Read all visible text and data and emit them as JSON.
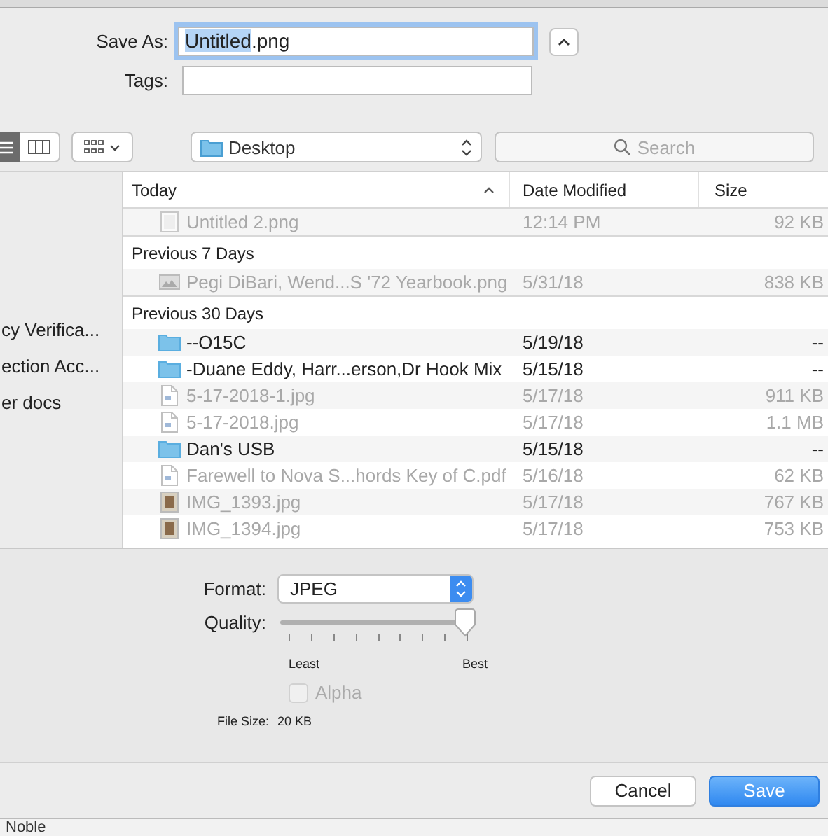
{
  "save_as": {
    "label": "Save As:",
    "value_selected": "Untitled",
    "value_rest": ".png"
  },
  "tags": {
    "label": "Tags:"
  },
  "view_modes": [
    {
      "kind": "list",
      "selected": true
    },
    {
      "kind": "columns",
      "selected": false
    }
  ],
  "location": {
    "label": "Desktop"
  },
  "search": {
    "placeholder": "Search"
  },
  "sidebar": {
    "items": [
      {
        "label": "cy Verifica..."
      },
      {
        "label": "ection Acc..."
      },
      {
        "label": "er docs"
      }
    ]
  },
  "columns": [
    {
      "label": "Today",
      "sorted": true
    },
    {
      "label": "Date Modified",
      "sorted": false
    },
    {
      "label": "Size",
      "sorted": false
    }
  ],
  "rows": [
    {
      "kind": "blank",
      "name": "Untitled 2.png",
      "date": "12:14 PM",
      "size": "92 KB",
      "disabled": true
    },
    {
      "kind": "group",
      "name": "Previous 7 Days"
    },
    {
      "kind": "image",
      "name": "Pegi DiBari, Wend...S '72 Yearbook.png",
      "date": "5/31/18",
      "size": "838 KB",
      "disabled": true
    },
    {
      "kind": "group",
      "name": "Previous 30 Days"
    },
    {
      "kind": "folder",
      "name": "--O15C",
      "date": "5/19/18",
      "size": "--",
      "disabled": false
    },
    {
      "kind": "folder",
      "name": "-Duane Eddy, Harr...erson,Dr Hook Mix",
      "date": "5/15/18",
      "size": "--",
      "disabled": false
    },
    {
      "kind": "document",
      "name": "5-17-2018-1.jpg",
      "date": "5/17/18",
      "size": "911 KB",
      "disabled": true
    },
    {
      "kind": "document",
      "name": "5-17-2018.jpg",
      "date": "5/17/18",
      "size": "1.1 MB",
      "disabled": true
    },
    {
      "kind": "folder",
      "name": "Dan's USB",
      "date": "5/15/18",
      "size": "--",
      "disabled": false
    },
    {
      "kind": "document",
      "name": "Farewell to Nova S...hords Key of C.pdf",
      "date": "5/16/18",
      "size": "62 KB",
      "disabled": true
    },
    {
      "kind": "photo",
      "name": "IMG_1393.jpg",
      "date": "5/17/18",
      "size": "767 KB",
      "disabled": true
    },
    {
      "kind": "photo",
      "name": "IMG_1394.jpg",
      "date": "5/17/18",
      "size": "753 KB",
      "disabled": true
    }
  ],
  "format": {
    "label": "Format:",
    "value": "JPEG"
  },
  "quality": {
    "label": "Quality:",
    "level": 1,
    "min_label": "Least",
    "max_label": "Best"
  },
  "alpha": {
    "label": "Alpha",
    "checked": false,
    "disabled": true
  },
  "file_size": {
    "label": "File Size:",
    "value": "20 KB"
  },
  "buttons": [
    {
      "label": "Cancel",
      "kind": "normal"
    },
    {
      "label": "Save",
      "kind": "default"
    }
  ],
  "background": {
    "text": "Noble"
  }
}
